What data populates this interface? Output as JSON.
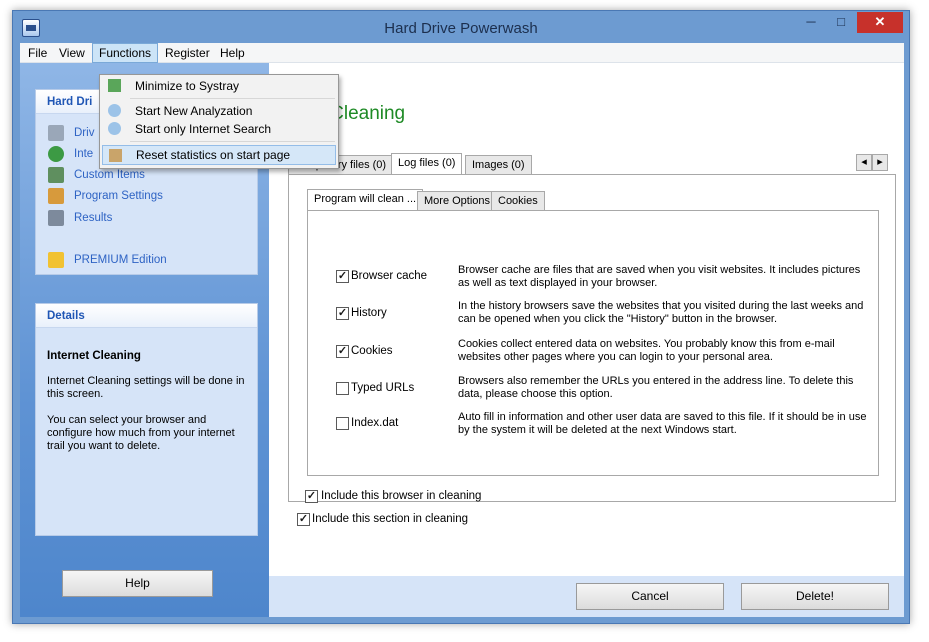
{
  "window": {
    "title": "Hard Drive Powerwash"
  },
  "window_controls": {
    "minimize": "─",
    "maximize": "□",
    "close": "✕"
  },
  "menubar": {
    "file": "File",
    "view": "View",
    "functions": "Functions",
    "register": "Register",
    "help": "Help"
  },
  "functions_menu": {
    "minimize": "Minimize to Systray",
    "start_analyzation": "Start New Analyzation",
    "start_internet_search": "Start only Internet Search",
    "reset_stats": "Reset statistics on start page"
  },
  "nav_panel": {
    "header": "Hard Dri",
    "items": [
      "Driv",
      "Inte",
      "Custom Items",
      "Program Settings",
      "Results",
      "PREMIUM Edition"
    ]
  },
  "details_panel": {
    "header": "Details",
    "title": "Internet Cleaning",
    "para1": "Internet Cleaning settings will be done in this screen.",
    "para2": "You can select your browser and configure how much from your internet trail you want to delete."
  },
  "main": {
    "title": "et Cleaning",
    "browser_tabs": [
      "Temporary files (0)",
      "Log files (0)",
      "Images (0)"
    ],
    "tab_scroll": {
      "left": "◂",
      "right": "▸"
    },
    "inner_tabs": [
      "Program will clean ...",
      "More Options",
      "Cookies"
    ],
    "options": [
      {
        "label": "Browser cache",
        "checked": true,
        "mark": "✓",
        "desc": "Browser cache are files that are saved when you visit websites. It includes pictures as well as text displayed in your browser."
      },
      {
        "label": "History",
        "checked": true,
        "mark": "✓",
        "desc": "In the history browsers save the websites that you visited during the last weeks and can be opened when you click the \"History\" button in the browser."
      },
      {
        "label": "Cookies",
        "checked": true,
        "mark": "✓",
        "desc": "Cookies collect entered data on websites. You probably know this from e-mail websites other pages where you can login to your personal area."
      },
      {
        "label": "Typed URLs",
        "checked": false,
        "mark": "",
        "desc": "Browsers also remember the URLs you entered in the address line. To delete this data, please choose this option."
      },
      {
        "label": "Index.dat",
        "checked": false,
        "mark": "",
        "desc": "Auto fill in information and other user data are saved to this file. If it should be in use by the system it will be deleted at the next Windows start."
      }
    ],
    "include_browser": {
      "label": "Include this browser in cleaning",
      "checked": true,
      "mark": "✓"
    },
    "include_section": {
      "label": "Include this section in cleaning",
      "checked": true,
      "mark": "✓"
    }
  },
  "buttons": {
    "help": "Help",
    "cancel": "Cancel",
    "delete": "Delete!"
  },
  "colors": {
    "accent": "#6d9bd1",
    "title_green": "#1e8a25",
    "link_blue": "#2e63c4",
    "close_red": "#c7312b"
  }
}
